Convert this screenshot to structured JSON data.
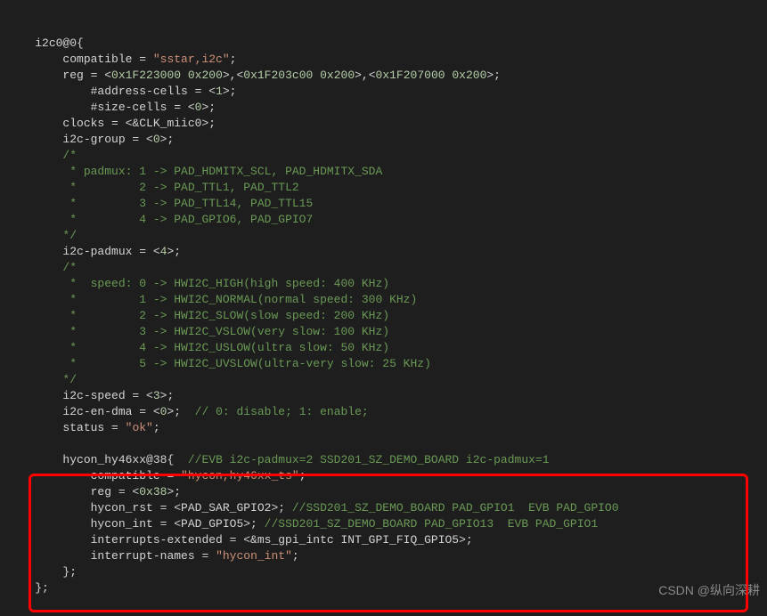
{
  "lines": [
    {
      "indent": 4,
      "tokens": [
        {
          "t": "i2c0@0{",
          "c": "c-default"
        }
      ]
    },
    {
      "indent": 8,
      "tokens": [
        {
          "t": "compatible = ",
          "c": "c-default"
        },
        {
          "t": "\"sstar,i2c\"",
          "c": "c-string"
        },
        {
          "t": ";",
          "c": "c-default"
        }
      ]
    },
    {
      "indent": 8,
      "tokens": [
        {
          "t": "reg = <",
          "c": "c-default"
        },
        {
          "t": "0x1F223000",
          "c": "c-number"
        },
        {
          "t": " ",
          "c": "c-default"
        },
        {
          "t": "0x200",
          "c": "c-number"
        },
        {
          "t": ">,<",
          "c": "c-default"
        },
        {
          "t": "0x1F203c00",
          "c": "c-number"
        },
        {
          "t": " ",
          "c": "c-default"
        },
        {
          "t": "0x200",
          "c": "c-number"
        },
        {
          "t": ">,<",
          "c": "c-default"
        },
        {
          "t": "0x1F207000",
          "c": "c-number"
        },
        {
          "t": " ",
          "c": "c-default"
        },
        {
          "t": "0x200",
          "c": "c-number"
        },
        {
          "t": ">;",
          "c": "c-default"
        }
      ]
    },
    {
      "indent": 12,
      "tokens": [
        {
          "t": "#address-cells = <",
          "c": "c-default"
        },
        {
          "t": "1",
          "c": "c-number"
        },
        {
          "t": ">;",
          "c": "c-default"
        }
      ]
    },
    {
      "indent": 12,
      "tokens": [
        {
          "t": "#size-cells = <",
          "c": "c-default"
        },
        {
          "t": "0",
          "c": "c-number"
        },
        {
          "t": ">;",
          "c": "c-default"
        }
      ]
    },
    {
      "indent": 8,
      "tokens": [
        {
          "t": "clocks = <&CLK_miic0>;",
          "c": "c-default"
        }
      ]
    },
    {
      "indent": 8,
      "tokens": [
        {
          "t": "i2c-group = <",
          "c": "c-default"
        },
        {
          "t": "0",
          "c": "c-number"
        },
        {
          "t": ">;",
          "c": "c-default"
        }
      ]
    },
    {
      "indent": 8,
      "tokens": [
        {
          "t": "/*",
          "c": "c-comment"
        }
      ]
    },
    {
      "indent": 8,
      "tokens": [
        {
          "t": " * padmux: 1 -> PAD_HDMITX_SCL, PAD_HDMITX_SDA",
          "c": "c-comment"
        }
      ]
    },
    {
      "indent": 8,
      "tokens": [
        {
          "t": " *         2 -> PAD_TTL1, PAD_TTL2",
          "c": "c-comment"
        }
      ]
    },
    {
      "indent": 8,
      "tokens": [
        {
          "t": " *         3 -> PAD_TTL14, PAD_TTL15",
          "c": "c-comment"
        }
      ]
    },
    {
      "indent": 8,
      "tokens": [
        {
          "t": " *         4 -> PAD_GPIO6, PAD_GPIO7",
          "c": "c-comment"
        }
      ]
    },
    {
      "indent": 8,
      "tokens": [
        {
          "t": "*/",
          "c": "c-comment"
        }
      ]
    },
    {
      "indent": 8,
      "tokens": [
        {
          "t": "i2c-padmux = <",
          "c": "c-default"
        },
        {
          "t": "4",
          "c": "c-number"
        },
        {
          "t": ">;",
          "c": "c-default"
        }
      ]
    },
    {
      "indent": 8,
      "tokens": [
        {
          "t": "/*",
          "c": "c-comment"
        }
      ]
    },
    {
      "indent": 8,
      "tokens": [
        {
          "t": " *  speed: 0 -> HWI2C_HIGH(high speed: 400 KHz)",
          "c": "c-comment"
        }
      ]
    },
    {
      "indent": 8,
      "tokens": [
        {
          "t": " *         1 -> HWI2C_NORMAL(normal speed: 300 KHz)",
          "c": "c-comment"
        }
      ]
    },
    {
      "indent": 8,
      "tokens": [
        {
          "t": " *         2 -> HWI2C_SLOW(slow speed: 200 KHz)",
          "c": "c-comment"
        }
      ]
    },
    {
      "indent": 8,
      "tokens": [
        {
          "t": " *         3 -> HWI2C_VSLOW(very slow: 100 KHz)",
          "c": "c-comment"
        }
      ]
    },
    {
      "indent": 8,
      "tokens": [
        {
          "t": " *         4 -> HWI2C_USLOW(ultra slow: 50 KHz)",
          "c": "c-comment"
        }
      ]
    },
    {
      "indent": 8,
      "tokens": [
        {
          "t": " *         5 -> HWI2C_UVSLOW(ultra-very slow: 25 KHz)",
          "c": "c-comment"
        }
      ]
    },
    {
      "indent": 8,
      "tokens": [
        {
          "t": "*/",
          "c": "c-comment"
        }
      ]
    },
    {
      "indent": 8,
      "tokens": [
        {
          "t": "i2c-speed = <",
          "c": "c-default"
        },
        {
          "t": "3",
          "c": "c-number"
        },
        {
          "t": ">;",
          "c": "c-default"
        }
      ]
    },
    {
      "indent": 8,
      "tokens": [
        {
          "t": "i2c-en-dma = <",
          "c": "c-default"
        },
        {
          "t": "0",
          "c": "c-number"
        },
        {
          "t": ">;  ",
          "c": "c-default"
        },
        {
          "t": "// 0: disable; 1: enable;",
          "c": "c-comment"
        }
      ]
    },
    {
      "indent": 8,
      "tokens": [
        {
          "t": "status = ",
          "c": "c-default"
        },
        {
          "t": "\"ok\"",
          "c": "c-string"
        },
        {
          "t": ";",
          "c": "c-default"
        }
      ]
    },
    {
      "indent": 0,
      "tokens": [
        {
          "t": " ",
          "c": "c-default"
        }
      ]
    },
    {
      "indent": 8,
      "tokens": [
        {
          "t": "hycon_hy46xx@38{  ",
          "c": "c-default"
        },
        {
          "t": "//EVB i2c-padmux=2 SSD201_SZ_DEMO_BOARD i2c-padmux=1",
          "c": "c-comment"
        }
      ]
    },
    {
      "indent": 12,
      "tokens": [
        {
          "t": "compatible = ",
          "c": "c-default"
        },
        {
          "t": "\"hycon,hy46xx_ts\"",
          "c": "c-string"
        },
        {
          "t": ";",
          "c": "c-default"
        }
      ]
    },
    {
      "indent": 12,
      "tokens": [
        {
          "t": "reg = <",
          "c": "c-default"
        },
        {
          "t": "0x38",
          "c": "c-number"
        },
        {
          "t": ">;",
          "c": "c-default"
        }
      ]
    },
    {
      "indent": 12,
      "tokens": [
        {
          "t": "hycon_rst = <PAD_SAR_GPIO2>; ",
          "c": "c-default"
        },
        {
          "t": "//SSD201_SZ_DEMO_BOARD PAD_GPIO1  EVB PAD_GPIO0",
          "c": "c-comment"
        }
      ]
    },
    {
      "indent": 12,
      "tokens": [
        {
          "t": "hycon_int = <PAD_GPIO5>; ",
          "c": "c-default"
        },
        {
          "t": "//SSD201_SZ_DEMO_BOARD PAD_GPIO13  EVB PAD_GPIO1",
          "c": "c-comment"
        }
      ]
    },
    {
      "indent": 12,
      "tokens": [
        {
          "t": "interrupts-extended = <&ms_gpi_intc INT_GPI_FIQ_GPIO5>;",
          "c": "c-default"
        }
      ]
    },
    {
      "indent": 12,
      "tokens": [
        {
          "t": "interrupt-names = ",
          "c": "c-default"
        },
        {
          "t": "\"hycon_int\"",
          "c": "c-string"
        },
        {
          "t": ";",
          "c": "c-default"
        }
      ]
    },
    {
      "indent": 8,
      "tokens": [
        {
          "t": "};",
          "c": "c-default"
        }
      ]
    },
    {
      "indent": 4,
      "tokens": [
        {
          "t": "};",
          "c": "c-default"
        }
      ]
    }
  ],
  "watermark": "CSDN @纵向深耕"
}
